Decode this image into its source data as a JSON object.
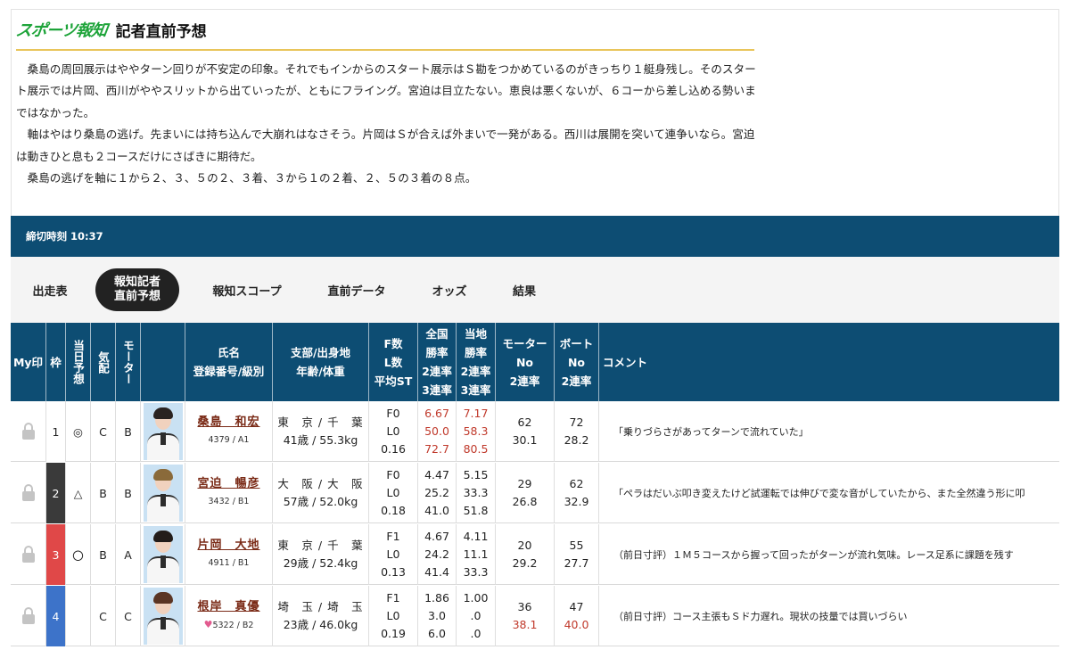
{
  "brand": {
    "logo": "スポーツ報知",
    "title": "記者直前予想",
    "green": "#1ea43a",
    "gold": "#e9c55a"
  },
  "article": [
    "桑島の周回展示はややターン回りが不安定の印象。それでもインからのスタート展示はＳ勘をつかめているのがきっちり１艇身残し。そのスタート展示では片岡、西川がややスリットから出ていったが、ともにフライング。宮迫は目立たない。恵良は悪くないが、６コーから差し込める勢いまではなかった。",
    "軸はやはり桑島の逃げ。先まいには持ち込んで大崩れはなさそう。片岡はＳが合えば外まいで一発がある。西川は展開を突いて連争いなら。宮迫は動きひと息も２コースだけにさばきに期待だ。",
    "桑島の逃げを軸に１から２、３、５の２、３着、３から１の２着、２、５の３着の８点。"
  ],
  "deadline": {
    "text": "締切時刻 10:37",
    "bg": "#0d4d73"
  },
  "tabs": [
    {
      "label": "出走表"
    },
    {
      "label": "報知記者\n直前予想",
      "active": true
    },
    {
      "label": "報知スコープ"
    },
    {
      "label": "直前データ"
    },
    {
      "label": "オッズ"
    },
    {
      "label": "結果"
    }
  ],
  "headers": {
    "mymark": "My印",
    "waku": "枠",
    "yoso": "当日予想",
    "kihai": "気配",
    "motor": "モーター",
    "name": "氏名\n登録番号/級別",
    "branch": "支部/出身地\n年齢/体重",
    "fl": "F数\nL数\n平均ST",
    "zenkoku": "全国\n勝率\n2連率\n3連率",
    "touchi": "当地\n勝率\n2連率\n3連率",
    "motor_no": "モーター\nNo\n2連率",
    "boat_no": "ボート\nNo\n2連率",
    "comment": "コメント"
  },
  "rows": [
    {
      "waku": "1",
      "waku_bg": "#ffffff",
      "waku_fg": "#222222",
      "yoso": "◎",
      "kihai": "C",
      "motor": "B",
      "hair": "#2a2320",
      "name": "桑島　和宏",
      "reg": "4379 / A1",
      "heart": false,
      "branch": "東　京 / 千　葉",
      "age": "41歳 / 55.3kg",
      "f": "F0",
      "l": "L0",
      "st": "0.16",
      "zen": [
        "6.67",
        "50.0",
        "72.7"
      ],
      "zen_red": true,
      "tou": [
        "7.17",
        "58.3",
        "80.5"
      ],
      "tou_red": true,
      "motor_no": "62",
      "motor_rate": "30.1",
      "motor_red": false,
      "boat_no": "72",
      "boat_rate": "28.2",
      "boat_red": false,
      "comment": "「乗りづらさがあってターンで流れていた」"
    },
    {
      "waku": "2",
      "waku_bg": "#3a3a3a",
      "waku_fg": "#ffffff",
      "yoso": "△",
      "kihai": "B",
      "motor": "B",
      "hair": "#8a6a3a",
      "name": "宮迫　暢彦",
      "reg": "3432 / B1",
      "heart": false,
      "branch": "大　阪 / 大　阪",
      "age": "57歳 / 52.0kg",
      "f": "F0",
      "l": "L0",
      "st": "0.18",
      "zen": [
        "4.47",
        "25.2",
        "41.0"
      ],
      "zen_red": false,
      "tou": [
        "5.15",
        "33.3",
        "51.8"
      ],
      "tou_red": false,
      "motor_no": "29",
      "motor_rate": "26.8",
      "motor_red": false,
      "boat_no": "62",
      "boat_rate": "32.9",
      "boat_red": false,
      "comment": "「ペラはだいぶ叩き変えたけど試運転では伸びで変な音がしていたから、また全然違う形に叩"
    },
    {
      "waku": "3",
      "waku_bg": "#e04848",
      "waku_fg": "#ffffff",
      "yoso": "〇",
      "kihai": "B",
      "motor": "A",
      "hair": "#231c19",
      "name": "片岡　大地",
      "reg": "4911 / B1",
      "heart": false,
      "branch": "東　京 / 千　葉",
      "age": "29歳 / 52.4kg",
      "f": "F1",
      "l": "L0",
      "st": "0.13",
      "zen": [
        "4.67",
        "24.2",
        "41.4"
      ],
      "zen_red": false,
      "tou": [
        "4.11",
        "11.1",
        "33.3"
      ],
      "tou_red": false,
      "motor_no": "20",
      "motor_rate": "29.2",
      "motor_red": false,
      "boat_no": "55",
      "boat_rate": "27.7",
      "boat_red": false,
      "comment": "（前日寸評）１Ｍ５コースから握って回ったがターンが流れ気味。レース足系に課題を残す"
    },
    {
      "waku": "4",
      "waku_bg": "#3d73c9",
      "waku_fg": "#ffffff",
      "yoso": "",
      "kihai": "C",
      "motor": "C",
      "hair": "#5a3524",
      "name": "根岸　真優",
      "reg": "5322 / B2",
      "heart": true,
      "branch": "埼　玉 / 埼　玉",
      "age": "23歳 / 46.0kg",
      "f": "F1",
      "l": "L0",
      "st": "0.19",
      "zen": [
        "1.86",
        "3.0",
        "6.0"
      ],
      "zen_red": false,
      "tou": [
        "1.00",
        ".0",
        ".0"
      ],
      "tou_red": false,
      "motor_no": "36",
      "motor_rate": "38.1",
      "motor_red": true,
      "boat_no": "47",
      "boat_rate": "40.0",
      "boat_red": true,
      "comment": "（前日寸評）コース主張もＳド力遅れ。現状の技量では買いづらい"
    }
  ],
  "colors": {
    "header_bg": "#0d4d73",
    "name_color": "#7a2a16",
    "red_value": "#c0392b"
  }
}
